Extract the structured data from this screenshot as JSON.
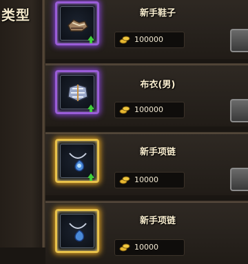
{
  "sidebar": {
    "title": "类型"
  },
  "items": [
    {
      "name": "新手鞋子",
      "price": "100000",
      "rarity": "purple",
      "icon": "shoes-icon"
    },
    {
      "name": "布衣(男)",
      "price": "100000",
      "rarity": "purple",
      "icon": "cloth-armor-icon"
    },
    {
      "name": "新手项链",
      "price": "10000",
      "rarity": "gold",
      "icon": "necklace-icon"
    },
    {
      "name": "新手项链",
      "price": "10000",
      "rarity": "gold",
      "icon": "necklace-icon"
    }
  ],
  "colors": {
    "purple_frame": "#9a5dd8",
    "gold_frame": "#e8c24a",
    "upgrade_arrow": "#3fcf3a"
  }
}
